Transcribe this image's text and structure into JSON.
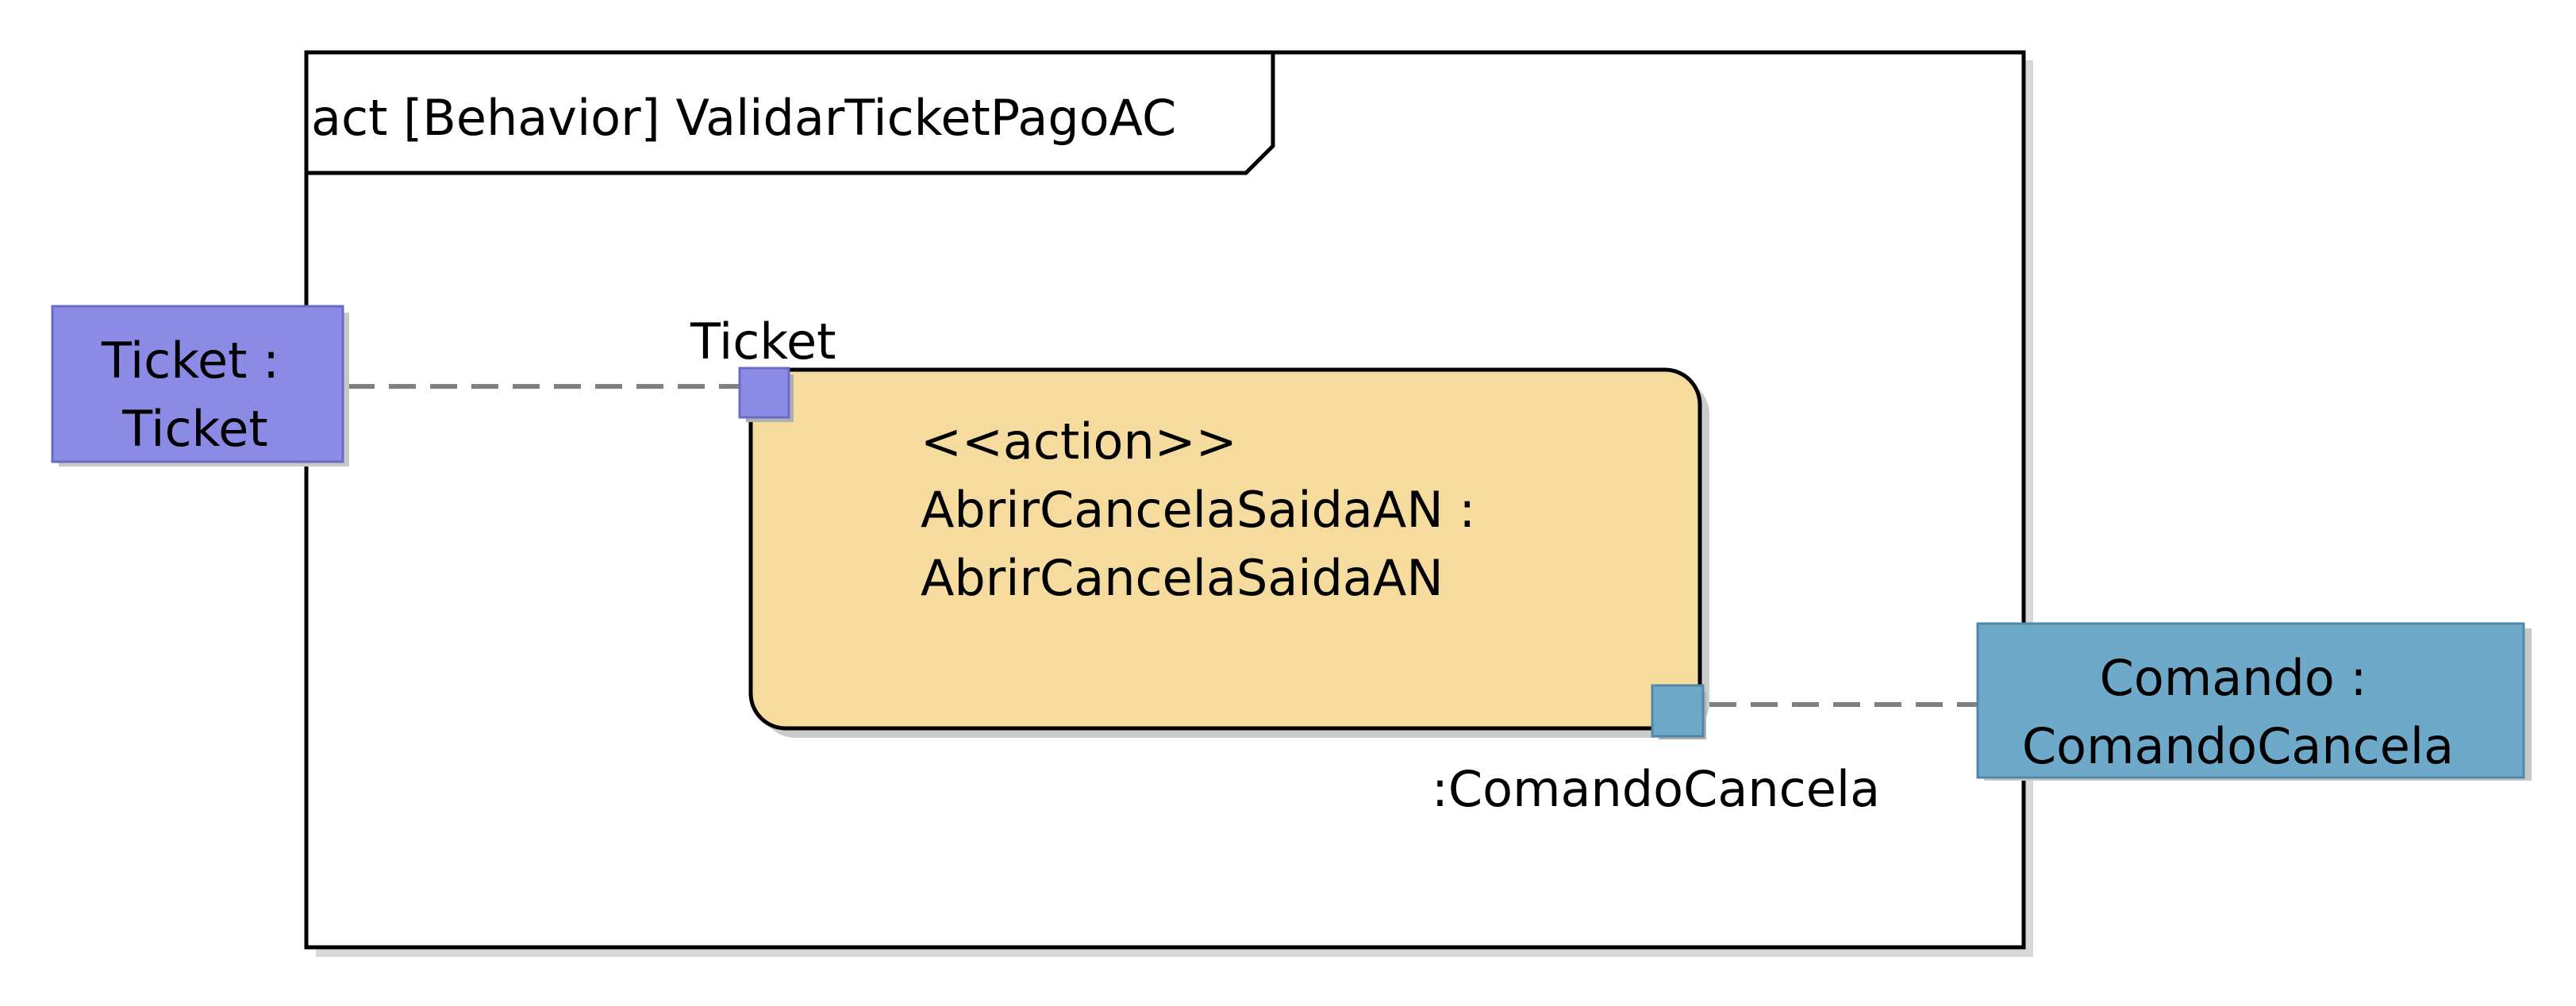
{
  "diagram": {
    "frame": {
      "title": "act [Behavior] ValidarTicketPagoAC"
    },
    "action": {
      "stereotype": "<<action>>",
      "name_line1": "AbrirCancelaSaidaAN :",
      "name_line2": "AbrirCancelaSaidaAN",
      "fill_color": "#F5DB9E"
    },
    "input_pin": {
      "label": "Ticket",
      "color": "#8B8BE6"
    },
    "output_pin": {
      "label": ":ComandoCancela",
      "color": "#6FA9C9"
    },
    "input_parameter": {
      "line1": "Ticket :",
      "line2": "Ticket",
      "color": "#8B8BE6"
    },
    "output_parameter": {
      "line1": "Comando :",
      "line2": "ComandoCancela",
      "color": "#6FA9C9"
    },
    "connector_color": "#808080"
  }
}
